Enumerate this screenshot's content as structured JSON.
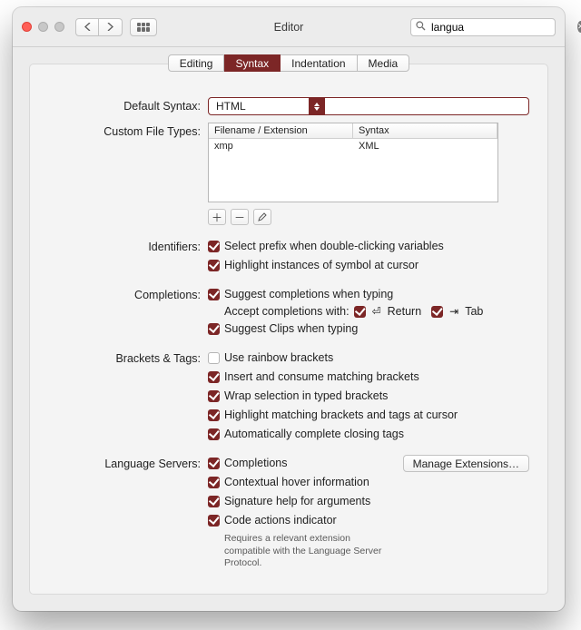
{
  "window": {
    "title": "Editor"
  },
  "search": {
    "value": "langua"
  },
  "tabs": [
    {
      "label": "Editing",
      "active": false
    },
    {
      "label": "Syntax",
      "active": true
    },
    {
      "label": "Indentation",
      "active": false
    },
    {
      "label": "Media",
      "active": false
    }
  ],
  "default_syntax": {
    "label": "Default Syntax:",
    "value": "HTML"
  },
  "custom_file_types": {
    "label": "Custom File Types:",
    "columns": {
      "filename": "Filename / Extension",
      "syntax": "Syntax"
    },
    "rows": [
      {
        "filename": "xmp",
        "syntax": "XML"
      }
    ]
  },
  "identifiers": {
    "label": "Identifiers:",
    "items": [
      {
        "checked": true,
        "text": "Select prefix when double-clicking variables"
      },
      {
        "checked": true,
        "text": "Highlight instances of symbol at cursor"
      }
    ]
  },
  "completions": {
    "label": "Completions:",
    "suggest": {
      "checked": true,
      "text": "Suggest completions when typing"
    },
    "accept_label": "Accept completions with:",
    "return": {
      "checked": true,
      "symbol": "⏎",
      "text": "Return"
    },
    "tab": {
      "checked": true,
      "symbol": "⇥",
      "text": "Tab"
    },
    "clips": {
      "checked": true,
      "text": "Suggest Clips when typing"
    }
  },
  "brackets": {
    "label": "Brackets & Tags:",
    "items": [
      {
        "checked": false,
        "text": "Use rainbow brackets"
      },
      {
        "checked": true,
        "text": "Insert and consume matching brackets"
      },
      {
        "checked": true,
        "text": "Wrap selection in typed brackets"
      },
      {
        "checked": true,
        "text": "Highlight matching brackets and tags at cursor"
      },
      {
        "checked": true,
        "text": "Automatically complete closing tags"
      }
    ]
  },
  "language_servers": {
    "label": "Language Servers:",
    "manage": "Manage Extensions…",
    "items": [
      {
        "checked": true,
        "text": "Completions"
      },
      {
        "checked": true,
        "text": "Contextual hover information"
      },
      {
        "checked": true,
        "text": "Signature help for arguments"
      },
      {
        "checked": true,
        "text": "Code actions indicator"
      }
    ],
    "hint": "Requires a relevant extension compatible with the Language Server Protocol."
  }
}
